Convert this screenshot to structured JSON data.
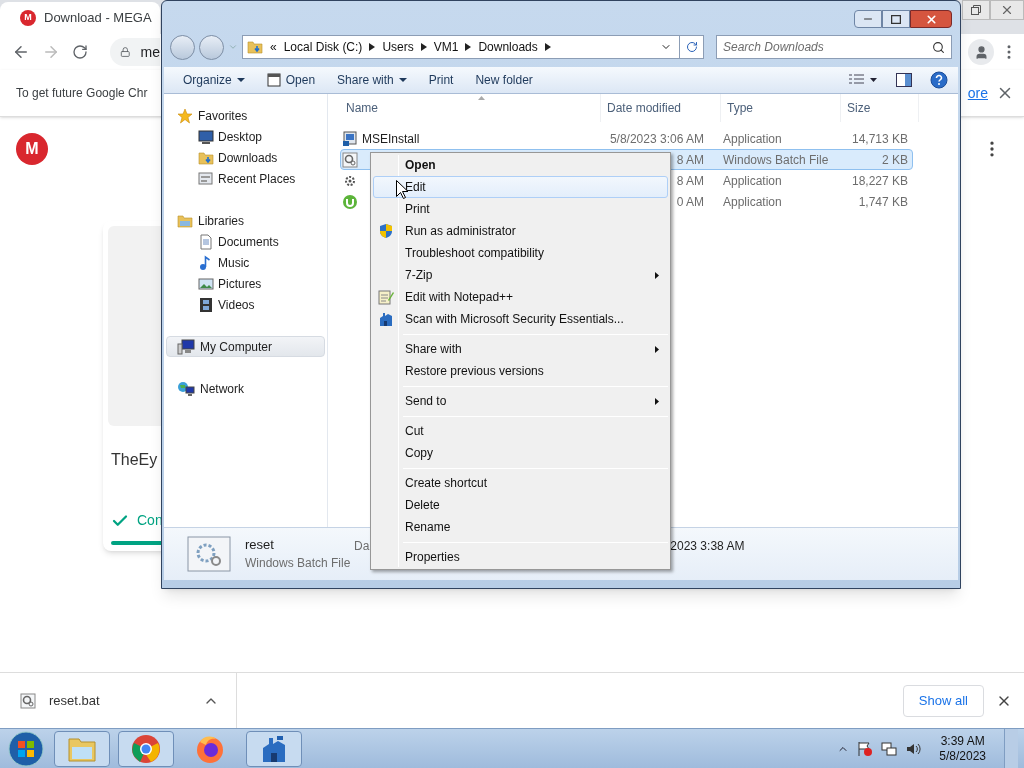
{
  "browser": {
    "tab": {
      "logo": "M",
      "title": "Download - MEGA"
    },
    "address": "me",
    "infobar": {
      "text": "To get future Google Chr",
      "link": "ore"
    },
    "page": {
      "logo": "M",
      "card_title": "TheEy",
      "status": "Con"
    },
    "download_bar": {
      "file": "reset.bat",
      "show_all": "Show all"
    }
  },
  "explorer": {
    "breadcrumb": {
      "overflow": "«",
      "parts": [
        "Local Disk (C:)",
        "Users",
        "VM1",
        "Downloads"
      ]
    },
    "search": {
      "placeholder": "Search Downloads"
    },
    "toolbar": [
      {
        "label": "Organize",
        "kind": "dropdown"
      },
      {
        "label": "Open",
        "kind": "icon"
      },
      {
        "label": "Share with",
        "kind": "dropdown"
      },
      {
        "label": "Print",
        "kind": "plain"
      },
      {
        "label": "New folder",
        "kind": "plain"
      }
    ],
    "nav": [
      {
        "label": "Favorites",
        "kind": "star",
        "selected": false,
        "children": [
          {
            "label": "Desktop",
            "kind": "desktop",
            "selected": false
          },
          {
            "label": "Downloads",
            "kind": "downloads",
            "selected": false
          },
          {
            "label": "Recent Places",
            "kind": "recent",
            "selected": false
          }
        ]
      },
      {
        "label": "Libraries",
        "kind": "library",
        "selected": false,
        "children": [
          {
            "label": "Documents",
            "kind": "documents",
            "selected": false
          },
          {
            "label": "Music",
            "kind": "music",
            "selected": false
          },
          {
            "label": "Pictures",
            "kind": "pictures",
            "selected": false
          },
          {
            "label": "Videos",
            "kind": "videos",
            "selected": false
          }
        ]
      },
      {
        "label": "My Computer",
        "kind": "computer",
        "selected": true
      },
      {
        "label": "Network",
        "kind": "network",
        "selected": false
      }
    ],
    "columns": [
      "Name",
      "Date modified",
      "Type",
      "Size"
    ],
    "files": [
      {
        "name": "MSEInstall",
        "kind": "installer",
        "date": "5/8/2023 3:06 AM",
        "type": "Application",
        "size": "14,713 KB",
        "selected": false
      },
      {
        "kind": "batch",
        "date": "8 AM",
        "type": "Windows Batch File",
        "size": "2 KB",
        "selected": true
      },
      {
        "kind": "gear",
        "date": "8 AM",
        "type": "Application",
        "size": "18,227 KB",
        "selected": false
      },
      {
        "kind": "torrent",
        "date": "0 AM",
        "type": "Application",
        "size": "1,747 KB",
        "selected": false
      }
    ],
    "details": {
      "name": "reset",
      "type": "Windows Batch File",
      "date_label": "Da",
      "date": "2023 3:38 AM"
    }
  },
  "context_menu": [
    {
      "kind": "item",
      "label": "Open",
      "bold": true,
      "hovered": false,
      "submenu": false
    },
    {
      "kind": "item",
      "label": "Edit",
      "bold": false,
      "hovered": true,
      "submenu": false
    },
    {
      "kind": "item",
      "label": "Print",
      "bold": false,
      "hovered": false,
      "submenu": false
    },
    {
      "kind": "item",
      "label": "Run as administrator",
      "bold": false,
      "hovered": false,
      "submenu": false
    },
    {
      "kind": "item",
      "label": "Troubleshoot compatibility",
      "bold": false,
      "hovered": false,
      "submenu": false
    },
    {
      "kind": "item",
      "label": "7-Zip",
      "bold": false,
      "hovered": false,
      "submenu": true
    },
    {
      "kind": "item",
      "label": "Edit with Notepad++",
      "bold": false,
      "hovered": false,
      "submenu": false
    },
    {
      "kind": "item",
      "label": "Scan with Microsoft Security Essentials...",
      "bold": false,
      "hovered": false,
      "submenu": false
    },
    {
      "kind": "separator"
    },
    {
      "kind": "item",
      "label": "Share with",
      "bold": false,
      "hovered": false,
      "submenu": true
    },
    {
      "kind": "item",
      "label": "Restore previous versions",
      "bold": false,
      "hovered": false,
      "submenu": false
    },
    {
      "kind": "separator"
    },
    {
      "kind": "item",
      "label": "Send to",
      "bold": false,
      "hovered": false,
      "submenu": true
    },
    {
      "kind": "separator"
    },
    {
      "kind": "item",
      "label": "Cut",
      "bold": false,
      "hovered": false,
      "submenu": false
    },
    {
      "kind": "item",
      "label": "Copy",
      "bold": false,
      "hovered": false,
      "submenu": false
    },
    {
      "kind": "separator"
    },
    {
      "kind": "item",
      "label": "Create shortcut",
      "bold": false,
      "hovered": false,
      "submenu": false
    },
    {
      "kind": "item",
      "label": "Delete",
      "bold": false,
      "hovered": false,
      "submenu": false
    },
    {
      "kind": "item",
      "label": "Rename",
      "bold": false,
      "hovered": false,
      "submenu": false
    },
    {
      "kind": "separator"
    },
    {
      "kind": "item",
      "label": "Properties",
      "bold": false,
      "hovered": false,
      "submenu": false
    }
  ],
  "taskbar": {
    "apps": [
      {
        "kind": "folder",
        "open": true
      },
      {
        "kind": "chrome",
        "open": true
      },
      {
        "kind": "firefox",
        "open": false
      },
      {
        "kind": "castle",
        "open": true
      }
    ],
    "time": "3:39 AM",
    "date": "5/8/2023"
  }
}
